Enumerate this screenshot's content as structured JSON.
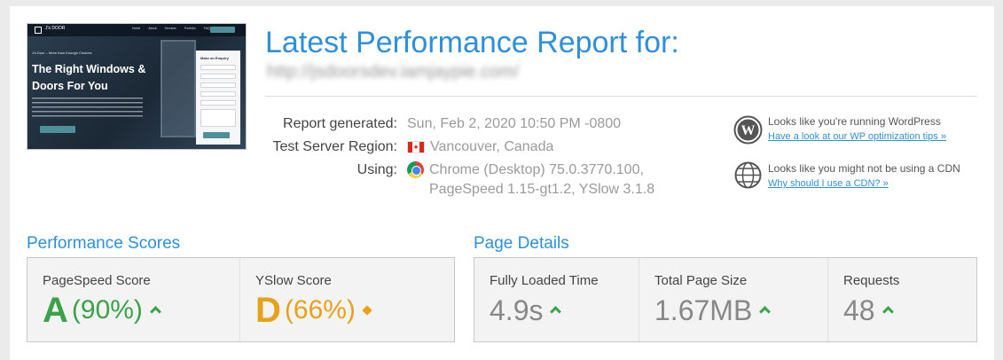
{
  "thumbnail": {
    "logo_text": "J's DOOR",
    "menu": [
      "Home",
      "About",
      "Services",
      "Portfolio",
      "FAQs",
      "Contact"
    ],
    "tagline": "J's Door – More than Enough Choices",
    "headline": "The Right Windows & Doors For You",
    "form_title": "Make an Enquiry",
    "alt_label": "Website screenshot"
  },
  "header": {
    "title": "Latest Performance Report for:",
    "url": "http://jsdoorsdev.iamjaypie.com/"
  },
  "meta": {
    "generated_label": "Report generated:",
    "generated_value": "Sun, Feb 2, 2020 10:50 PM -0800",
    "region_label": "Test Server Region:",
    "region_value": "Vancouver, Canada",
    "using_label": "Using:",
    "using_value_1": "Chrome (Desktop) 75.0.3770.100,",
    "using_value_2": "PageSpeed 1.15-gt1.2, YSlow 3.1.8"
  },
  "tips": [
    {
      "icon": "wordpress-icon",
      "text": "Looks like you're running WordPress",
      "link": "Have a look at our WP optimization tips »"
    },
    {
      "icon": "globe-icon",
      "text": "Looks like you might not be using a CDN",
      "link": "Why should I use a CDN? »"
    }
  ],
  "performance": {
    "title": "Performance Scores",
    "pagespeed": {
      "label": "PageSpeed Score",
      "grade": "A",
      "pct": "(90%)",
      "trend": "up"
    },
    "yslow": {
      "label": "YSlow Score",
      "grade": "D",
      "pct": "(66%)",
      "trend": "neutral"
    }
  },
  "details": {
    "title": "Page Details",
    "load_time": {
      "label": "Fully Loaded Time",
      "value": "4.9s",
      "trend": "up"
    },
    "page_size": {
      "label": "Total Page Size",
      "value": "1.67MB",
      "trend": "up"
    },
    "requests": {
      "label": "Requests",
      "value": "48",
      "trend": "up"
    }
  },
  "colors": {
    "accent": "#2f8fd8",
    "grade_a": "#3aa34a",
    "grade_d": "#e8a21a",
    "trend_up": "#3aa34a"
  }
}
